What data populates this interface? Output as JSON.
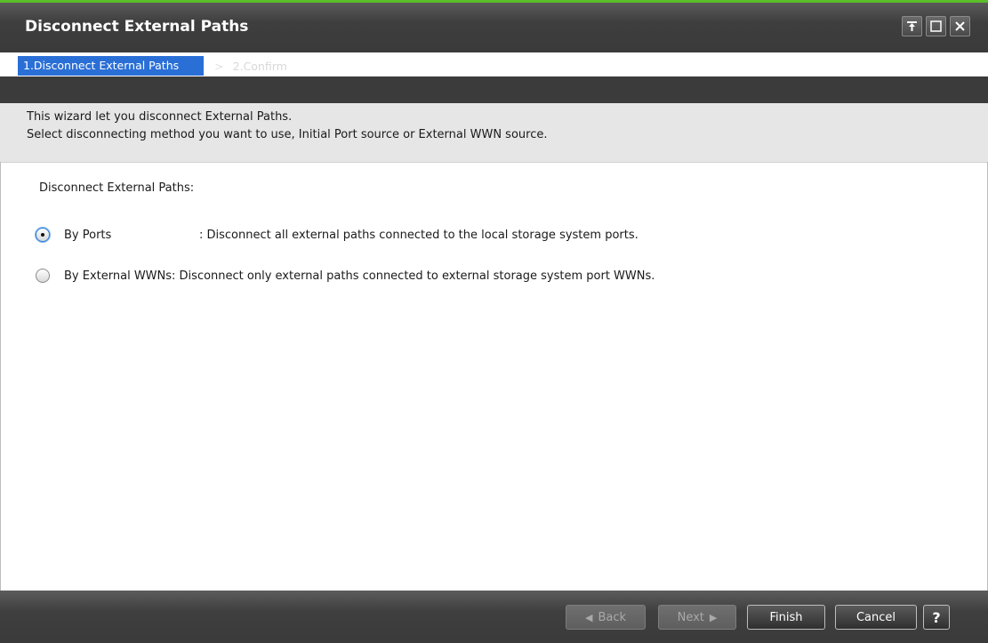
{
  "window": {
    "title": "Disconnect External Paths",
    "controls": [
      "pin-icon",
      "maximize-icon",
      "close-icon"
    ]
  },
  "steps": {
    "step1": "1.Disconnect External Paths",
    "separator": ">",
    "step2": "2.Confirm"
  },
  "intro": {
    "line1": "This wizard let you disconnect External Paths.",
    "line2": "Select disconnecting method you want to use, Initial Port source or External WWN source."
  },
  "form": {
    "label": "Disconnect External Paths:",
    "options": [
      {
        "label": "By Ports",
        "description": ": Disconnect all external paths connected to the local storage system ports.",
        "selected": true
      },
      {
        "label": "By External WWNs",
        "description": ": Disconnect only external paths connected to external storage system port WWNs.",
        "selected": false
      }
    ]
  },
  "footer": {
    "back": "Back",
    "next": "Next",
    "finish": "Finish",
    "cancel": "Cancel",
    "help": "?"
  },
  "colors": {
    "accent_green": "#5bbf2a",
    "active_step": "#2a6fd6",
    "chrome_dark": "#3b3b3b"
  }
}
